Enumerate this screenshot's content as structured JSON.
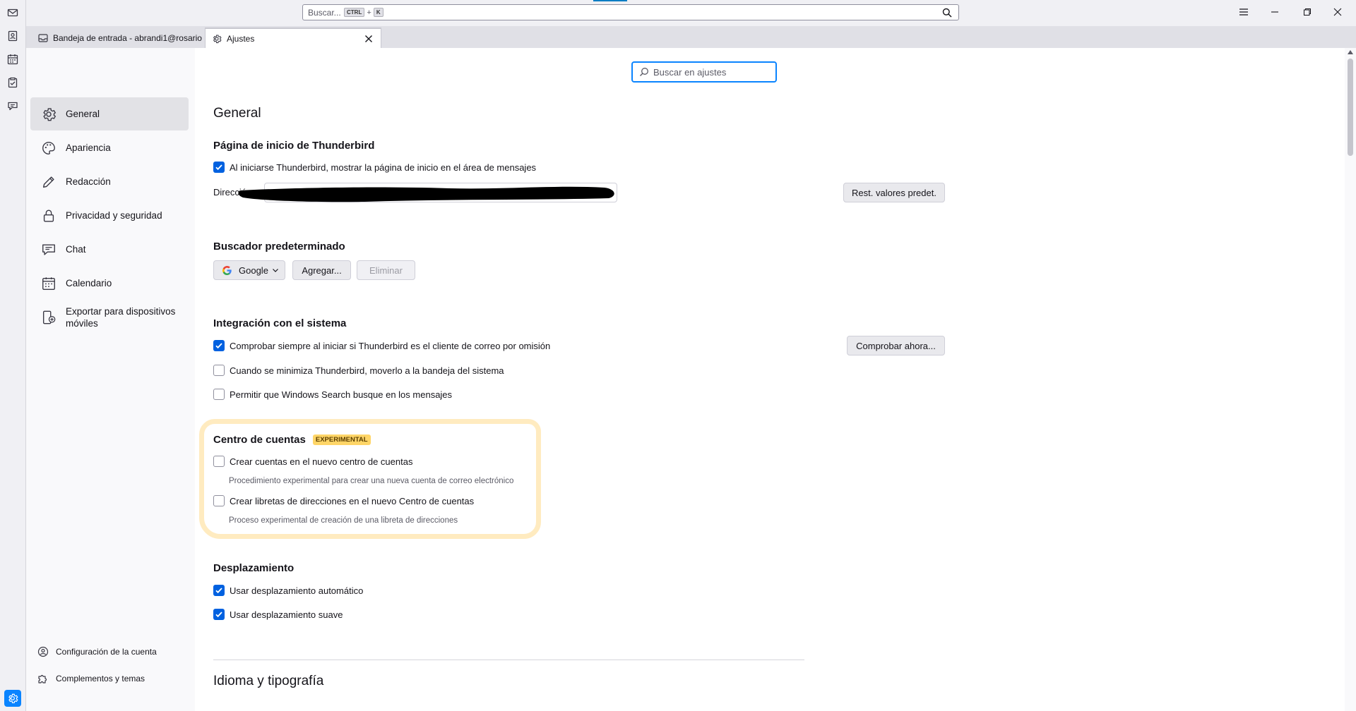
{
  "titlebar": {
    "search_placeholder": "Buscar...",
    "shortcut_ctrl": "CTRL",
    "shortcut_plus": "+",
    "shortcut_key": "K"
  },
  "tabs": [
    {
      "label": "Bandeja de entrada - abrandi1@rosario"
    },
    {
      "label": "Ajustes"
    }
  ],
  "nav": {
    "items": [
      {
        "label": "General",
        "icon": "gear-icon",
        "selected": true
      },
      {
        "label": "Apariencia",
        "icon": "palette-icon"
      },
      {
        "label": "Redacción",
        "icon": "pencil-icon"
      },
      {
        "label": "Privacidad y seguridad",
        "icon": "lock-icon"
      },
      {
        "label": "Chat",
        "icon": "chat-icon"
      },
      {
        "label": "Calendario",
        "icon": "calendar-icon"
      },
      {
        "label": "Exportar para dispositivos móviles",
        "icon": "mobile-export-icon"
      }
    ],
    "bottom": [
      {
        "label": "Configuración de la cuenta",
        "icon": "account-settings-icon"
      },
      {
        "label": "Complementos y temas",
        "icon": "puzzle-icon"
      }
    ]
  },
  "settings_search": {
    "placeholder": "Buscar en ajustes"
  },
  "general": {
    "title": "General",
    "start_page": {
      "heading": "Página de inicio de Thunderbird",
      "show_start_page": {
        "label": "Al iniciarse Thunderbird, mostrar la página de inicio en el área de mensajes",
        "checked": true
      },
      "address_label": "Dirección:",
      "restore_button": "Rest. valores predet."
    },
    "search_engine": {
      "heading": "Buscador predeterminado",
      "selected": "Google",
      "add_button": "Agregar...",
      "remove_button": "Eliminar"
    },
    "system_integration": {
      "heading": "Integración con el sistema",
      "check_now_button": "Comprobar ahora...",
      "options": [
        {
          "label": "Comprobar siempre al iniciar si Thunderbird es el cliente de correo por omisión",
          "checked": true
        },
        {
          "label": "Cuando se minimiza Thunderbird, moverlo a la bandeja del sistema",
          "checked": false
        },
        {
          "label": "Permitir que Windows Search busque en los mensajes",
          "checked": false
        }
      ]
    },
    "account_hub": {
      "heading": "Centro de cuentas",
      "badge": "EXPERIMENTAL",
      "options": [
        {
          "label": "Crear cuentas en el nuevo centro de cuentas",
          "description": "Procedimiento experimental para crear una nueva cuenta de correo electrónico",
          "checked": false
        },
        {
          "label": "Crear libretas de direcciones en el nuevo Centro de cuentas",
          "description": "Proceso experimental de creación de una libreta de direcciones",
          "checked": false
        }
      ]
    },
    "scrolling": {
      "heading": "Desplazamiento",
      "options": [
        {
          "label": "Usar desplazamiento automático",
          "checked": true
        },
        {
          "label": "Usar desplazamiento suave",
          "checked": true
        }
      ]
    }
  },
  "language": {
    "title": "Idioma y tipografía"
  },
  "colors": {
    "accent": "#0a84ff",
    "checkbox": "#0061e0",
    "badge": "#ffd567",
    "highlight": "#ffda8c"
  }
}
